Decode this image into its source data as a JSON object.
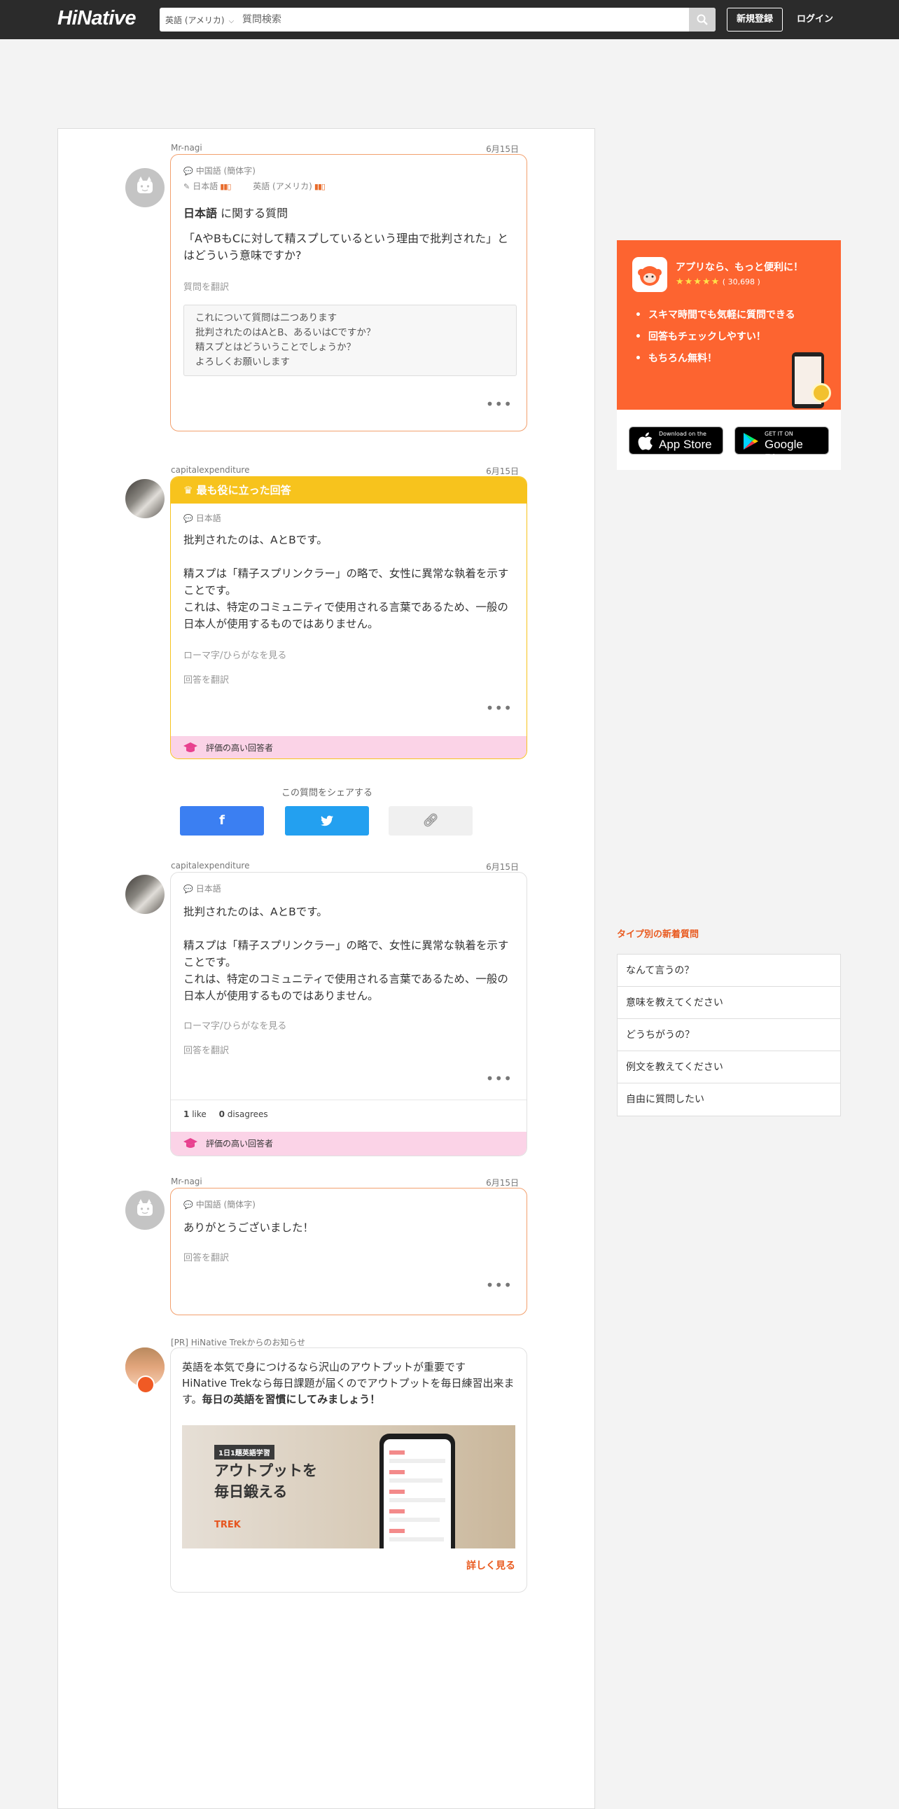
{
  "header": {
    "logo": "HiNative",
    "language_select": "英語 (アメリカ)",
    "search_placeholder": "質問検索",
    "signup_label": "新規登録",
    "login_label": "ログイン"
  },
  "question": {
    "author": "Mr-nagi",
    "date": "6月15日",
    "native_language": "中国語 (簡体字)",
    "study_lang_1": "日本語",
    "study_lang_2": "英語 (アメリカ)",
    "topic_lang": "日本語",
    "topic_suffix": " に関する質問",
    "text": "「AやBもCに対して精スプしているという理由で批判された」とはどういう意味ですか?",
    "translate_link": "質問を翻訳",
    "note_lines": [
      "これについて質問は二つあります",
      "批判されたのはAとB、あるいはCですか？",
      "精スプとはどういうことでしょうか？",
      "よろしくお願いします"
    ]
  },
  "best_answer": {
    "author": "capitalexpenditure",
    "date": "6月15日",
    "banner": "最も役に立った回答",
    "language": "日本語",
    "lines": [
      "批判されたのは、AとBです。",
      "精スプは「精子スプリンクラー」の略で、女性に異常な執着を示すことです。",
      "これは、特定のコミュニティで使用される言葉であるため、一般の日本人が使用するものではありません。"
    ],
    "romaji_link": "ローマ字/ひらがなを見る",
    "translate_link": "回答を翻訳",
    "badge": "評価の高い回答者"
  },
  "share": {
    "label": "この質問をシェアする"
  },
  "answer2": {
    "author": "capitalexpenditure",
    "date": "6月15日",
    "language": "日本語",
    "lines": [
      "批判されたのは、AとBです。",
      "精スプは「精子スプリンクラー」の略で、女性に異常な執着を示すことです。",
      "これは、特定のコミュニティで使用される言葉であるため、一般の日本人が使用するものではありません。"
    ],
    "romaji_link": "ローマ字/ひらがなを見る",
    "translate_link": "回答を翻訳",
    "likes": "1",
    "likes_label": "like",
    "disagrees": "0",
    "disagrees_label": "disagrees",
    "badge": "評価の高い回答者"
  },
  "reply": {
    "author": "Mr-nagi",
    "date": "6月15日",
    "language": "中国語 (簡体字)",
    "text": "ありがとうございました！",
    "translate_link": "回答を翻訳"
  },
  "pr": {
    "label": "[PR] HiNative Trekからのお知らせ",
    "text_1": "英語を本気で身につけるなら沢山のアウトプットが重要です",
    "text_2": "HiNative Trekなら毎日課題が届くのでアウトプットを毎日練習出来ます。",
    "text_bold": "毎日の英語を習慣にしてみましょう！",
    "banner_tag": "1日1題英語学習",
    "banner_head_1": "アウトプットを",
    "banner_head_2": "毎日鍛える",
    "banner_logo": "TREK",
    "more_link": "詳しく見る"
  },
  "sidebar": {
    "promo": {
      "title": "アプリなら、もっと便利に！",
      "stars": "★★★★★",
      "rating": "( 30,698 )",
      "points": [
        "スキマ時間でも気軽に質問できる",
        "回答もチェックしやすい！",
        "もちろん無料！"
      ]
    },
    "app_store_small": "Download on the",
    "app_store_big": "App Store",
    "google_play_small": "GET IT ON",
    "google_play_big": "Google Play",
    "new_questions_title": "タイプ別の新着質問",
    "new_questions": [
      "なんて言うの？",
      "意味を教えてください",
      "どうちがうの？",
      "例文を教えてください",
      "自由に質問したい"
    ]
  },
  "colors": {
    "header_bg": "#2b2b2b",
    "accent_orange": "#fd6430",
    "best_answer_yellow": "#f7c31d",
    "badge_pink": "#fbd3e7",
    "facebook": "#3b7ff2",
    "twitter": "#23a0f0"
  }
}
